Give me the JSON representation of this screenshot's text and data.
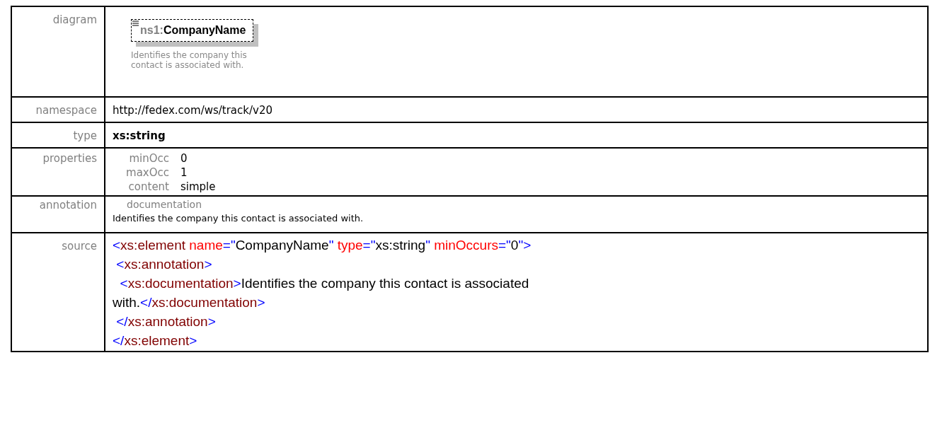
{
  "rows": [
    {
      "kind": "diagram",
      "label": "diagram",
      "element": {
        "prefix": "ns1:",
        "name": "CompanyName"
      },
      "description": "Identifies the company this contact is associated with."
    },
    {
      "kind": "text",
      "label": "namespace",
      "value": "http://fedex.com/ws/track/v20"
    },
    {
      "kind": "bold",
      "label": "type",
      "value": "xs:string"
    },
    {
      "kind": "properties",
      "label": "properties",
      "items": [
        {
          "name": "minOcc",
          "value": "0"
        },
        {
          "name": "maxOcc",
          "value": "1"
        },
        {
          "name": "content",
          "value": "simple"
        }
      ]
    },
    {
      "kind": "annotation",
      "label": "annotation",
      "heading": "documentation",
      "value": "Identifies the company this contact is associated with."
    },
    {
      "kind": "source",
      "label": "source",
      "lines": [
        [
          {
            "kind": "bracket",
            "text": "<"
          },
          {
            "kind": "tag",
            "text": "xs:element"
          },
          {
            "kind": "attr",
            "text": " name"
          },
          {
            "kind": "bracket",
            "text": "=\""
          },
          {
            "kind": "text",
            "text": "CompanyName"
          },
          {
            "kind": "bracket",
            "text": "\""
          },
          {
            "kind": "attr",
            "text": " type"
          },
          {
            "kind": "bracket",
            "text": "=\""
          },
          {
            "kind": "text",
            "text": "xs:string"
          },
          {
            "kind": "bracket",
            "text": "\""
          },
          {
            "kind": "attr",
            "text": " minOccurs"
          },
          {
            "kind": "bracket",
            "text": "=\""
          },
          {
            "kind": "text",
            "text": "0"
          },
          {
            "kind": "bracket",
            "text": "\">"
          }
        ],
        [
          {
            "kind": "bracket",
            "text": " <"
          },
          {
            "kind": "tag",
            "text": "xs:annotation"
          },
          {
            "kind": "bracket",
            "text": ">"
          }
        ],
        [
          {
            "kind": "bracket",
            "text": "  <"
          },
          {
            "kind": "tag",
            "text": "xs:documentation"
          },
          {
            "kind": "bracket",
            "text": ">"
          },
          {
            "kind": "text",
            "text": "Identifies the company this contact is associated"
          }
        ],
        [
          {
            "kind": "text",
            "text": "with."
          },
          {
            "kind": "bracket",
            "text": "</"
          },
          {
            "kind": "tag",
            "text": "xs:documentation"
          },
          {
            "kind": "bracket",
            "text": ">"
          }
        ],
        [
          {
            "kind": "bracket",
            "text": " </"
          },
          {
            "kind": "tag",
            "text": "xs:annotation"
          },
          {
            "kind": "bracket",
            "text": ">"
          }
        ],
        [
          {
            "kind": "bracket",
            "text": "</"
          },
          {
            "kind": "tag",
            "text": "xs:element"
          },
          {
            "kind": "bracket",
            "text": ">"
          }
        ]
      ]
    }
  ]
}
